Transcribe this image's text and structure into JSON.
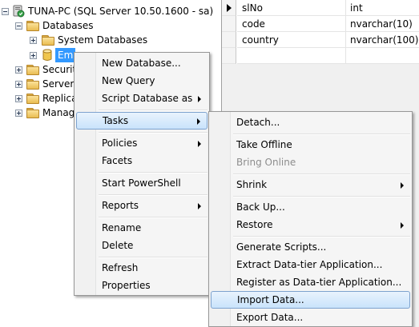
{
  "tree": {
    "server": "TUNA-PC (SQL Server 10.50.1600 - sa)",
    "databases": "Databases",
    "system_databases": "System Databases",
    "selected_db": "Em",
    "security": "Securit",
    "server_objects": "Server C",
    "replication": "Replica",
    "management": "Manag"
  },
  "grid": {
    "rows": [
      {
        "name": "slNo",
        "type": "int"
      },
      {
        "name": "code",
        "type": "nvarchar(10)"
      },
      {
        "name": "country",
        "type": "nvarchar(100)"
      }
    ]
  },
  "menu": {
    "new_database": "New Database...",
    "new_query": "New Query",
    "script_database_as": "Script Database as",
    "tasks": "Tasks",
    "policies": "Policies",
    "facets": "Facets",
    "start_powershell": "Start PowerShell",
    "reports": "Reports",
    "rename": "Rename",
    "delete": "Delete",
    "refresh": "Refresh",
    "properties": "Properties"
  },
  "submenu": {
    "detach": "Detach...",
    "take_offline": "Take Offline",
    "bring_online": "Bring Online",
    "shrink": "Shrink",
    "back_up": "Back Up...",
    "restore": "Restore",
    "generate_scripts": "Generate Scripts...",
    "extract_data_tier": "Extract Data-tier Application...",
    "register_data_tier": "Register as Data-tier Application...",
    "import_data": "Import Data...",
    "export_data": "Export Data..."
  },
  "colors": {
    "selection": "#3399ff",
    "menu_highlight": "#c9e3fb",
    "menu_background": "#f5f5f5"
  }
}
